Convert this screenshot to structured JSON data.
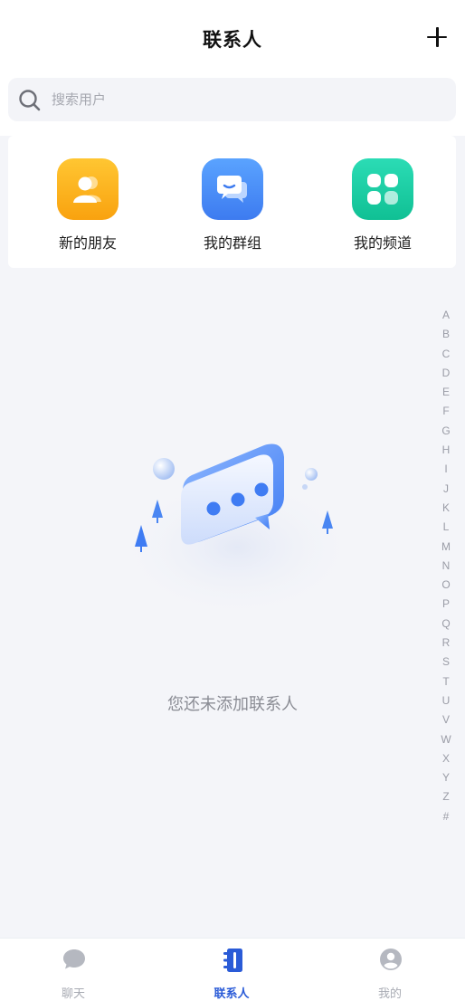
{
  "header": {
    "title": "联系人"
  },
  "search": {
    "placeholder": "搜索用户"
  },
  "quick_actions": [
    {
      "label": "新的朋友",
      "icon": "new-friend-icon",
      "color": "#fbb21f"
    },
    {
      "label": "我的群组",
      "icon": "group-chat-icon",
      "color": "#4a8cf7"
    },
    {
      "label": "我的频道",
      "icon": "channel-icon",
      "color": "#1fcfa6"
    }
  ],
  "index_letters": [
    "A",
    "B",
    "C",
    "D",
    "E",
    "F",
    "G",
    "H",
    "I",
    "J",
    "K",
    "L",
    "M",
    "N",
    "O",
    "P",
    "Q",
    "R",
    "S",
    "T",
    "U",
    "V",
    "W",
    "X",
    "Y",
    "Z",
    "#"
  ],
  "empty_state": {
    "message": "您还未添加联系人"
  },
  "tabbar": {
    "tabs": [
      {
        "label": "聊天",
        "icon": "chat-bubble-icon",
        "active": false
      },
      {
        "label": "联系人",
        "icon": "contacts-book-icon",
        "active": true
      },
      {
        "label": "我的",
        "icon": "profile-icon",
        "active": false
      }
    ],
    "active_color": "#2a5bd7"
  }
}
